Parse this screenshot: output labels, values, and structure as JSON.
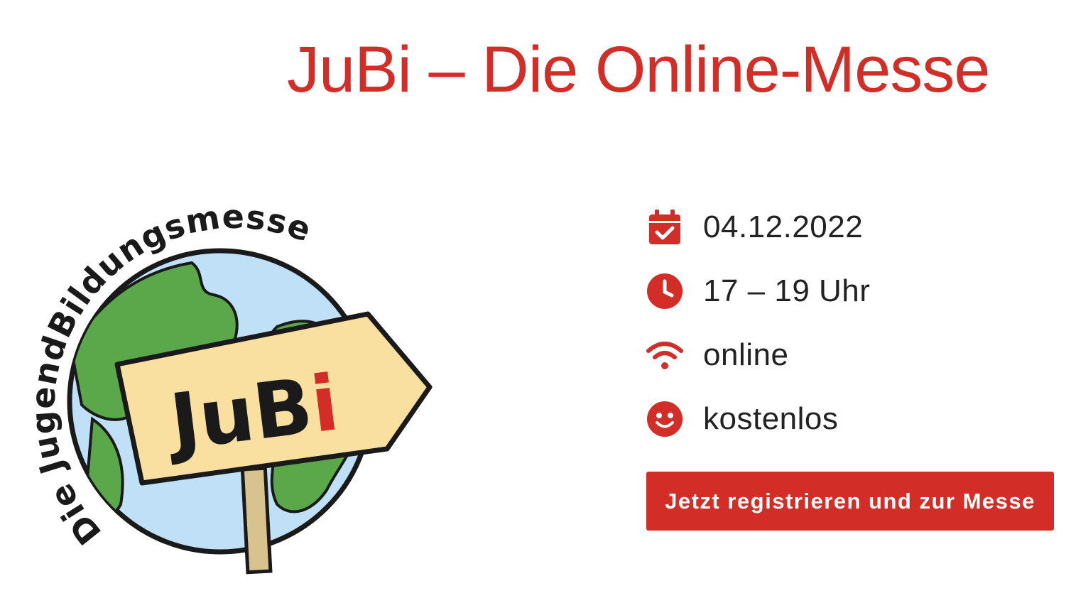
{
  "header": {
    "title": "JuBi – Die Online-Messe"
  },
  "logo": {
    "arc_text": "Die JugendBildungsmesse",
    "sign_text_main": "JuB",
    "sign_text_accent": "i"
  },
  "event": {
    "items": [
      {
        "icon": "calendar-check-icon",
        "text": "04.12.2022"
      },
      {
        "icon": "clock-icon",
        "text": "17 – 19 Uhr"
      },
      {
        "icon": "wifi-icon",
        "text": "online"
      },
      {
        "icon": "smiley-icon",
        "text": "kostenlos"
      }
    ]
  },
  "cta": {
    "label": "Jetzt registrieren und zur Messe"
  },
  "colors": {
    "accent": "#d22d27",
    "text": "#222222",
    "ocean": "#bfe0f6",
    "land": "#5aa84a",
    "sign": "#f9dfa0",
    "post": "#d8c38e"
  }
}
